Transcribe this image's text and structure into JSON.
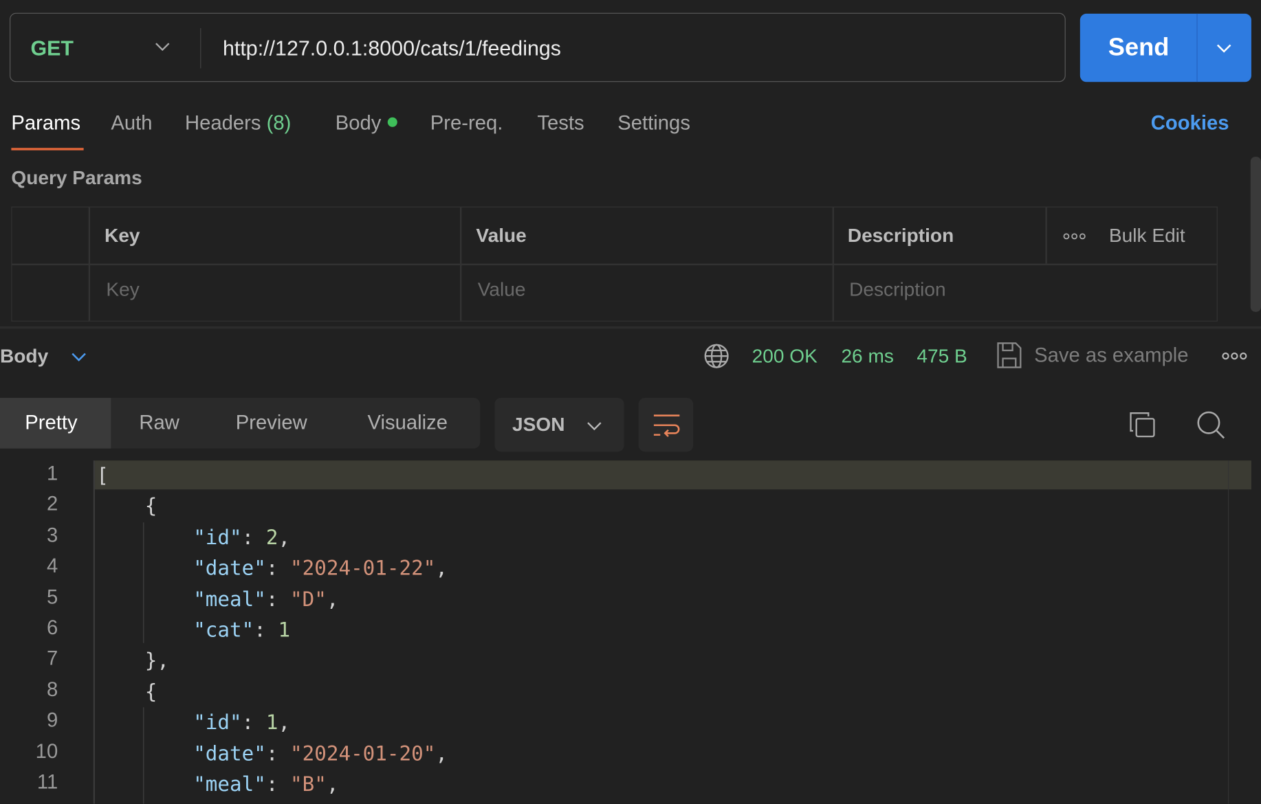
{
  "request": {
    "method": "GET",
    "url": "http://127.0.0.1:8000/cats/1/feedings",
    "send_label": "Send"
  },
  "tabs": [
    {
      "label": "Params",
      "active": true
    },
    {
      "label": "Auth"
    },
    {
      "label": "Headers",
      "count": "(8)"
    },
    {
      "label": "Body",
      "indicator": "green-dot"
    },
    {
      "label": "Pre-req."
    },
    {
      "label": "Tests"
    },
    {
      "label": "Settings"
    }
  ],
  "cookies_label": "Cookies",
  "query_params": {
    "title": "Query Params",
    "columns": [
      "Key",
      "Value",
      "Description"
    ],
    "bulk_edit": "Bulk Edit",
    "placeholders": {
      "key": "Key",
      "value": "Value",
      "description": "Description"
    }
  },
  "response": {
    "section_label": "Body",
    "status": "200 OK",
    "time": "26 ms",
    "size": "475 B",
    "save_label": "Save as example",
    "views": [
      "Pretty",
      "Raw",
      "Preview",
      "Visualize"
    ],
    "active_view": "Pretty",
    "format": "JSON"
  },
  "code_lines": [
    {
      "n": "1",
      "parts": [
        [
          "p",
          "["
        ]
      ]
    },
    {
      "n": "2",
      "parts": [
        [
          "p",
          "    {"
        ]
      ]
    },
    {
      "n": "3",
      "parts": [
        [
          "p",
          "        "
        ],
        [
          "k",
          "\"id\""
        ],
        [
          "p",
          ": "
        ],
        [
          "n",
          "2"
        ],
        [
          "p",
          ","
        ]
      ]
    },
    {
      "n": "4",
      "parts": [
        [
          "p",
          "        "
        ],
        [
          "k",
          "\"date\""
        ],
        [
          "p",
          ": "
        ],
        [
          "s",
          "\"2024-01-22\""
        ],
        [
          "p",
          ","
        ]
      ]
    },
    {
      "n": "5",
      "parts": [
        [
          "p",
          "        "
        ],
        [
          "k",
          "\"meal\""
        ],
        [
          "p",
          ": "
        ],
        [
          "s",
          "\"D\""
        ],
        [
          "p",
          ","
        ]
      ]
    },
    {
      "n": "6",
      "parts": [
        [
          "p",
          "        "
        ],
        [
          "k",
          "\"cat\""
        ],
        [
          "p",
          ": "
        ],
        [
          "n",
          "1"
        ]
      ]
    },
    {
      "n": "7",
      "parts": [
        [
          "p",
          "    },"
        ]
      ]
    },
    {
      "n": "8",
      "parts": [
        [
          "p",
          "    {"
        ]
      ]
    },
    {
      "n": "9",
      "parts": [
        [
          "p",
          "        "
        ],
        [
          "k",
          "\"id\""
        ],
        [
          "p",
          ": "
        ],
        [
          "n",
          "1"
        ],
        [
          "p",
          ","
        ]
      ]
    },
    {
      "n": "10",
      "parts": [
        [
          "p",
          "        "
        ],
        [
          "k",
          "\"date\""
        ],
        [
          "p",
          ": "
        ],
        [
          "s",
          "\"2024-01-20\""
        ],
        [
          "p",
          ","
        ]
      ]
    },
    {
      "n": "11",
      "parts": [
        [
          "p",
          "        "
        ],
        [
          "k",
          "\"meal\""
        ],
        [
          "p",
          ": "
        ],
        [
          "s",
          "\"B\""
        ],
        [
          "p",
          ","
        ]
      ]
    }
  ],
  "colors": {
    "accent": "#2e7be0",
    "method": "#6fcf8f",
    "status": "#6fcf8f",
    "active_tab_underline": "#e0663a",
    "cookies": "#4c9bf0"
  }
}
